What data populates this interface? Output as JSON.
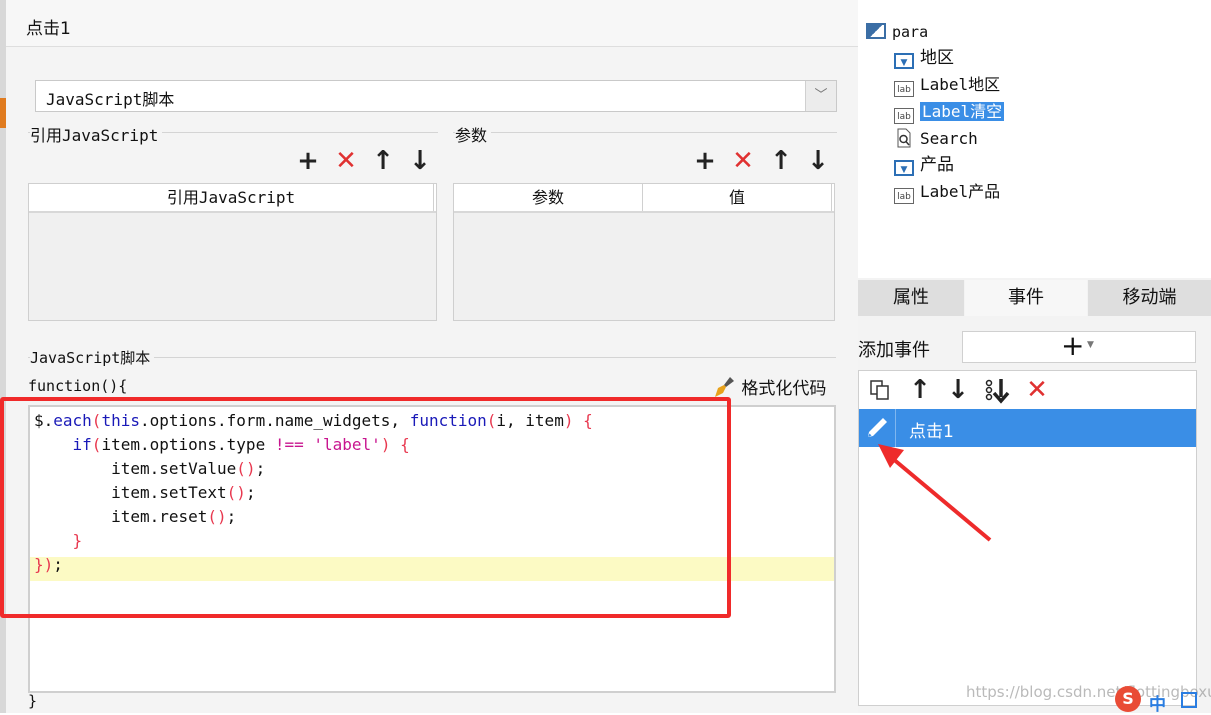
{
  "dialog": {
    "title": "点击1",
    "script_type": "JavaScript脚本",
    "ref_section": {
      "label": "引用JavaScript",
      "column": "引用JavaScript"
    },
    "param_section": {
      "label": "参数",
      "columns": [
        "参数",
        "值"
      ]
    },
    "toolbar_icons": [
      "add-icon",
      "delete-icon",
      "move-up-icon",
      "move-down-icon"
    ],
    "script_section": {
      "label": "JavaScript脚本",
      "header": "function(){",
      "format_label": "格式化代码",
      "footer": "}",
      "code_lines": [
        "$.each(this.options.form.name_widgets, function(i, item) {",
        "    if(item.options.type !== 'label') {",
        "        item.setValue();",
        "        item.setText();",
        "        item.reset();",
        "    }",
        "});"
      ]
    }
  },
  "tree": {
    "root": "para",
    "items": [
      {
        "label": "地区",
        "icon": "combo-icon"
      },
      {
        "label": "Label地区",
        "icon": "label-icon"
      },
      {
        "label": "Label清空",
        "icon": "label-icon",
        "selected": true
      },
      {
        "label": "Search",
        "icon": "search-icon"
      },
      {
        "label": "产品",
        "icon": "combo-icon"
      },
      {
        "label": "Label产品",
        "icon": "label-icon"
      }
    ],
    "label_icon_text": "lab"
  },
  "tabs": [
    "属性",
    "事件",
    "移动端"
  ],
  "events": {
    "add_label": "添加事件",
    "items": [
      "点击1"
    ]
  },
  "watermark": "https://blog.csdn.net/flottingboxue",
  "colors": {
    "selection": "#3a8ee6",
    "highlight_box": "#f02a2a",
    "current_line": "#fcfac4"
  }
}
